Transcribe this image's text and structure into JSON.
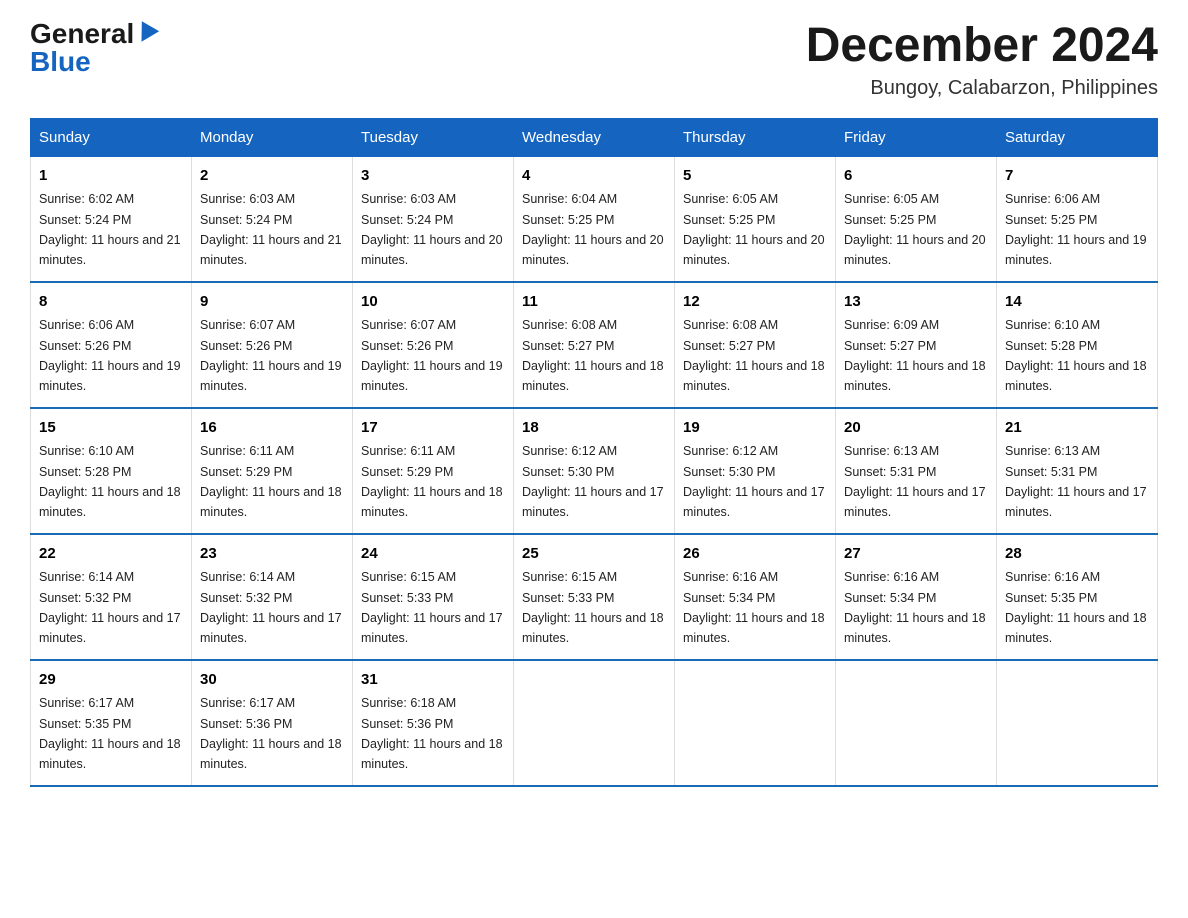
{
  "logo": {
    "general": "General",
    "blue": "Blue"
  },
  "title": {
    "month_year": "December 2024",
    "location": "Bungoy, Calabarzon, Philippines"
  },
  "headers": [
    "Sunday",
    "Monday",
    "Tuesday",
    "Wednesday",
    "Thursday",
    "Friday",
    "Saturday"
  ],
  "weeks": [
    [
      {
        "num": "1",
        "sunrise": "6:02 AM",
        "sunset": "5:24 PM",
        "daylight": "11 hours and 21 minutes."
      },
      {
        "num": "2",
        "sunrise": "6:03 AM",
        "sunset": "5:24 PM",
        "daylight": "11 hours and 21 minutes."
      },
      {
        "num": "3",
        "sunrise": "6:03 AM",
        "sunset": "5:24 PM",
        "daylight": "11 hours and 20 minutes."
      },
      {
        "num": "4",
        "sunrise": "6:04 AM",
        "sunset": "5:25 PM",
        "daylight": "11 hours and 20 minutes."
      },
      {
        "num": "5",
        "sunrise": "6:05 AM",
        "sunset": "5:25 PM",
        "daylight": "11 hours and 20 minutes."
      },
      {
        "num": "6",
        "sunrise": "6:05 AM",
        "sunset": "5:25 PM",
        "daylight": "11 hours and 20 minutes."
      },
      {
        "num": "7",
        "sunrise": "6:06 AM",
        "sunset": "5:25 PM",
        "daylight": "11 hours and 19 minutes."
      }
    ],
    [
      {
        "num": "8",
        "sunrise": "6:06 AM",
        "sunset": "5:26 PM",
        "daylight": "11 hours and 19 minutes."
      },
      {
        "num": "9",
        "sunrise": "6:07 AM",
        "sunset": "5:26 PM",
        "daylight": "11 hours and 19 minutes."
      },
      {
        "num": "10",
        "sunrise": "6:07 AM",
        "sunset": "5:26 PM",
        "daylight": "11 hours and 19 minutes."
      },
      {
        "num": "11",
        "sunrise": "6:08 AM",
        "sunset": "5:27 PM",
        "daylight": "11 hours and 18 minutes."
      },
      {
        "num": "12",
        "sunrise": "6:08 AM",
        "sunset": "5:27 PM",
        "daylight": "11 hours and 18 minutes."
      },
      {
        "num": "13",
        "sunrise": "6:09 AM",
        "sunset": "5:27 PM",
        "daylight": "11 hours and 18 minutes."
      },
      {
        "num": "14",
        "sunrise": "6:10 AM",
        "sunset": "5:28 PM",
        "daylight": "11 hours and 18 minutes."
      }
    ],
    [
      {
        "num": "15",
        "sunrise": "6:10 AM",
        "sunset": "5:28 PM",
        "daylight": "11 hours and 18 minutes."
      },
      {
        "num": "16",
        "sunrise": "6:11 AM",
        "sunset": "5:29 PM",
        "daylight": "11 hours and 18 minutes."
      },
      {
        "num": "17",
        "sunrise": "6:11 AM",
        "sunset": "5:29 PM",
        "daylight": "11 hours and 18 minutes."
      },
      {
        "num": "18",
        "sunrise": "6:12 AM",
        "sunset": "5:30 PM",
        "daylight": "11 hours and 17 minutes."
      },
      {
        "num": "19",
        "sunrise": "6:12 AM",
        "sunset": "5:30 PM",
        "daylight": "11 hours and 17 minutes."
      },
      {
        "num": "20",
        "sunrise": "6:13 AM",
        "sunset": "5:31 PM",
        "daylight": "11 hours and 17 minutes."
      },
      {
        "num": "21",
        "sunrise": "6:13 AM",
        "sunset": "5:31 PM",
        "daylight": "11 hours and 17 minutes."
      }
    ],
    [
      {
        "num": "22",
        "sunrise": "6:14 AM",
        "sunset": "5:32 PM",
        "daylight": "11 hours and 17 minutes."
      },
      {
        "num": "23",
        "sunrise": "6:14 AM",
        "sunset": "5:32 PM",
        "daylight": "11 hours and 17 minutes."
      },
      {
        "num": "24",
        "sunrise": "6:15 AM",
        "sunset": "5:33 PM",
        "daylight": "11 hours and 17 minutes."
      },
      {
        "num": "25",
        "sunrise": "6:15 AM",
        "sunset": "5:33 PM",
        "daylight": "11 hours and 18 minutes."
      },
      {
        "num": "26",
        "sunrise": "6:16 AM",
        "sunset": "5:34 PM",
        "daylight": "11 hours and 18 minutes."
      },
      {
        "num": "27",
        "sunrise": "6:16 AM",
        "sunset": "5:34 PM",
        "daylight": "11 hours and 18 minutes."
      },
      {
        "num": "28",
        "sunrise": "6:16 AM",
        "sunset": "5:35 PM",
        "daylight": "11 hours and 18 minutes."
      }
    ],
    [
      {
        "num": "29",
        "sunrise": "6:17 AM",
        "sunset": "5:35 PM",
        "daylight": "11 hours and 18 minutes."
      },
      {
        "num": "30",
        "sunrise": "6:17 AM",
        "sunset": "5:36 PM",
        "daylight": "11 hours and 18 minutes."
      },
      {
        "num": "31",
        "sunrise": "6:18 AM",
        "sunset": "5:36 PM",
        "daylight": "11 hours and 18 minutes."
      },
      null,
      null,
      null,
      null
    ]
  ]
}
